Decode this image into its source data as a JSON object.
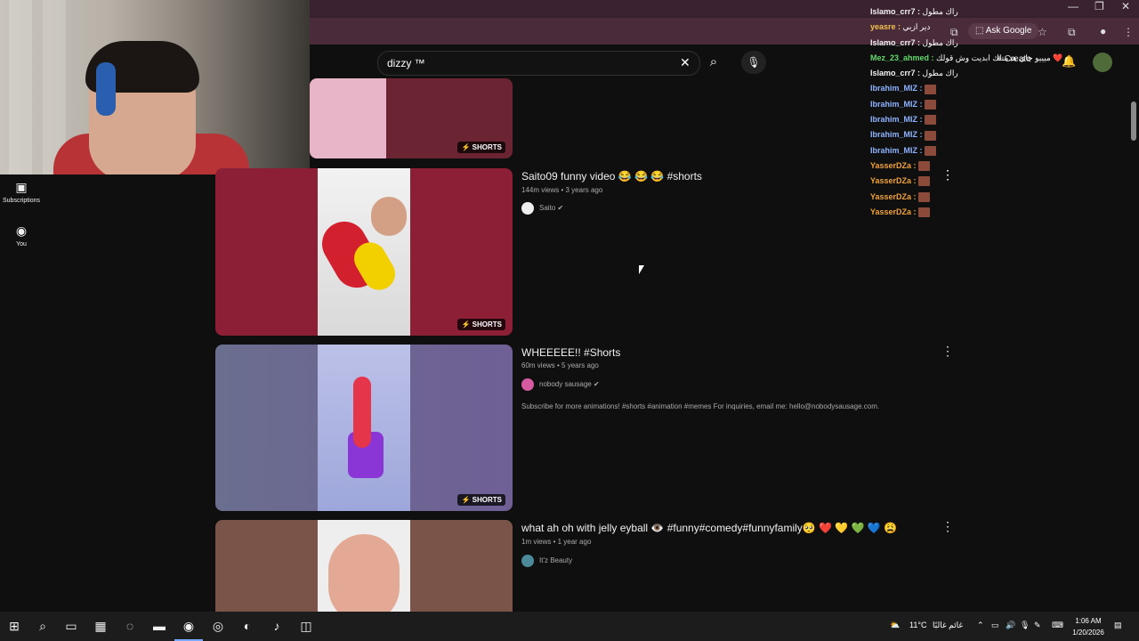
{
  "browser": {
    "ask_google_label": "Ask Google",
    "window_minimize": "—",
    "window_restore": "❐",
    "window_close": "✕"
  },
  "guide": {
    "subscriptions_label": "Subscriptions",
    "you_label": "You"
  },
  "search": {
    "query": "dizzy ™"
  },
  "topbar": {
    "create_label": "+ Create"
  },
  "results": [
    {
      "title": "",
      "badge": "SHORTS"
    },
    {
      "title": "Saito09 funny video 😂 😂 😂 #shorts",
      "views": "144m views",
      "age": "3 years ago",
      "channel": "Saito",
      "badge": "SHORTS"
    },
    {
      "title": "WHEEEEE!! #Shorts",
      "views": "60m views",
      "age": "5 years ago",
      "channel": "nobody sausage",
      "description": "Subscribe for more animations! #shorts #animation #memes For inquiries, email me: hello@nobodysausage.com.",
      "badge": "SHORTS"
    },
    {
      "title": "what ah oh with jelly eyball 👁️ #funny#comedy#funnyfamily🥺 ❤️ 💛 💚 💙 😩",
      "views": "1m views",
      "age": "1 year ago",
      "channel": "It'z Beauty"
    }
  ],
  "chat": [
    {
      "user": "Islamo_crr7",
      "msg": "راك مطول",
      "color": "#f1f1f1"
    },
    {
      "user": "yeasre",
      "msg": "دير ازبي",
      "color": "#f2c14e"
    },
    {
      "user": "Islamo_crr7",
      "msg": "راك مطول",
      "color": "#f1f1f1"
    },
    {
      "user": "Mez_23_ahmed",
      "msg": "ميييو جاي هدمتلك ابديت وش قولك ❤️",
      "color": "#63d86e"
    },
    {
      "user": "Islamo_crr7",
      "msg": "راك مطول",
      "color": "#f1f1f1"
    },
    {
      "user": "Ibrahim_MIZ",
      "msg": "",
      "color": "#8fb3ff"
    },
    {
      "user": "Ibrahim_MIZ",
      "msg": "",
      "color": "#8fb3ff"
    },
    {
      "user": "Ibrahim_MIZ",
      "msg": "",
      "color": "#8fb3ff"
    },
    {
      "user": "Ibrahim_MIZ",
      "msg": "",
      "color": "#8fb3ff"
    },
    {
      "user": "Ibrahim_MIZ",
      "msg": "",
      "color": "#8fb3ff"
    },
    {
      "user": "YasserDZa",
      "msg": "",
      "color": "#f2a23a"
    },
    {
      "user": "YasserDZa",
      "msg": "",
      "color": "#f2a23a"
    },
    {
      "user": "YasserDZa",
      "msg": "",
      "color": "#f2a23a"
    },
    {
      "user": "YasserDZa",
      "msg": "",
      "color": "#f2a23a"
    }
  ],
  "taskbar": {
    "weather_temp": "11°C",
    "weather_desc": "غائم غالبًا",
    "time": "1:06 AM",
    "date": "1/20/2026"
  },
  "colors": {
    "accent": "#3ea6ff",
    "background": "#0f0f0f"
  }
}
